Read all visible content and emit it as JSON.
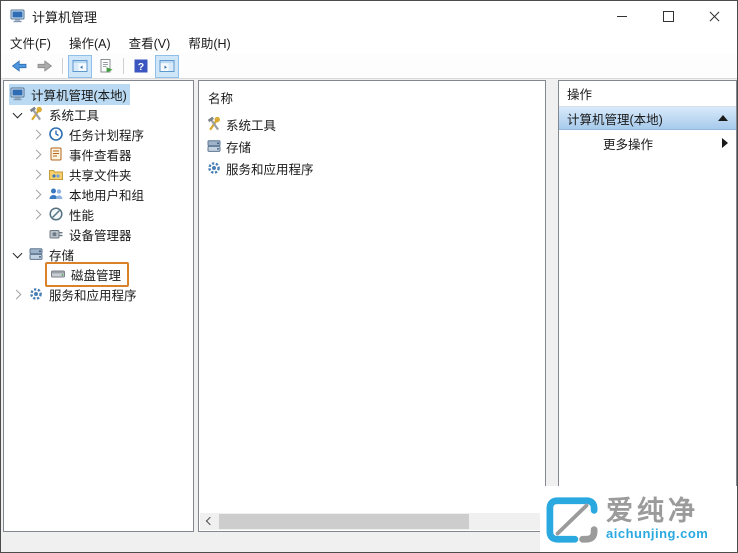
{
  "window": {
    "title": "计算机管理",
    "icons": [
      "computer-management-icon",
      "minimize-icon",
      "maximize-icon",
      "close-icon"
    ]
  },
  "menubar": {
    "items": [
      {
        "label": "文件(F)"
      },
      {
        "label": "操作(A)"
      },
      {
        "label": "查看(V)"
      },
      {
        "label": "帮助(H)"
      }
    ]
  },
  "toolbar": {
    "icons": [
      "back-arrow-icon",
      "forward-arrow-icon",
      "console-tree-toggle-icon",
      "export-list-icon",
      "help-icon",
      "action-pane-toggle-icon"
    ],
    "toggled_on": [
      "console-tree-toggle-icon",
      "action-pane-toggle-icon"
    ]
  },
  "tree": {
    "items": [
      {
        "label": "计算机管理(本地)",
        "level": 0,
        "expander": "none",
        "icon": "computer-icon",
        "selected": true
      },
      {
        "label": "系统工具",
        "level": 1,
        "expander": "expanded",
        "icon": "tools-icon"
      },
      {
        "label": "任务计划程序",
        "level": 2,
        "expander": "collapsed",
        "icon": "task-scheduler-icon"
      },
      {
        "label": "事件查看器",
        "level": 2,
        "expander": "collapsed",
        "icon": "event-viewer-icon"
      },
      {
        "label": "共享文件夹",
        "level": 2,
        "expander": "collapsed",
        "icon": "shared-folders-icon"
      },
      {
        "label": "本地用户和组",
        "level": 2,
        "expander": "collapsed",
        "icon": "local-users-icon"
      },
      {
        "label": "性能",
        "level": 2,
        "expander": "collapsed",
        "icon": "performance-icon"
      },
      {
        "label": "设备管理器",
        "level": 2,
        "expander": "none",
        "icon": "device-manager-icon"
      },
      {
        "label": "存储",
        "level": 1,
        "expander": "expanded",
        "icon": "storage-icon"
      },
      {
        "label": "磁盘管理",
        "level": 2,
        "expander": "none",
        "icon": "disk-management-icon",
        "annotated": true
      },
      {
        "label": "服务和应用程序",
        "level": 1,
        "expander": "collapsed",
        "icon": "services-icon"
      }
    ]
  },
  "list": {
    "header": "名称",
    "items": [
      {
        "label": "系统工具",
        "icon": "tools-icon"
      },
      {
        "label": "存储",
        "icon": "storage-icon"
      },
      {
        "label": "服务和应用程序",
        "icon": "services-icon"
      }
    ]
  },
  "actions": {
    "header": "操作",
    "group_title": "计算机管理(本地)",
    "group_collapse_icon": "collapse-up-icon",
    "more_actions": "更多操作",
    "more_actions_icon": "expand-right-icon"
  },
  "watermark": {
    "name": "爱纯净",
    "domain": "aichunjing.com"
  },
  "colors": {
    "annotation_orange": "#d9822a",
    "tree_selection_blue": "#b9daf2",
    "actions_bar_gradient_top": "#d8eafa",
    "actions_bar_gradient_bottom": "#a7caec",
    "watermark_blue": "#29a9e0",
    "watermark_gray": "#9b9b9b",
    "panel_border": "#828790"
  }
}
